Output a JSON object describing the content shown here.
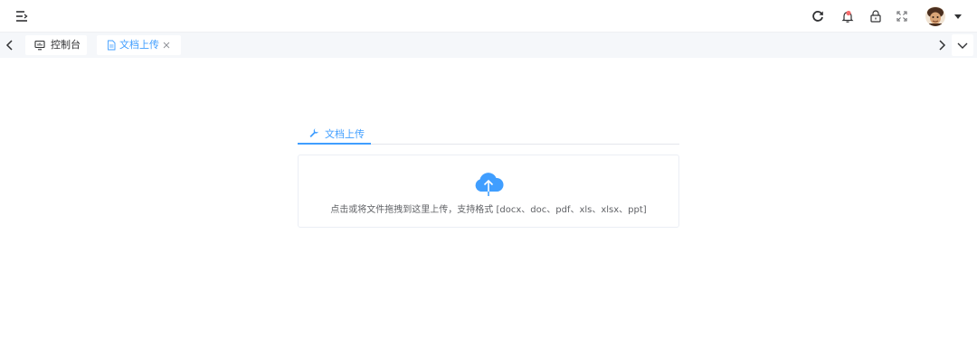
{
  "header": {
    "menu_icon": "hamburger-icon",
    "actions": [
      "refresh-icon",
      "bell-icon",
      "lock-icon",
      "fullscreen-icon"
    ],
    "avatar": "user-avatar"
  },
  "tags": [
    {
      "label": "控制台",
      "icon": "dashboard-icon",
      "active": false
    },
    {
      "label": "文档上传",
      "icon": "document-icon",
      "active": true
    }
  ],
  "content": {
    "tab_label": "文档上传",
    "tab_icon": "wrench-icon",
    "upload_icon": "cloud-upload-icon",
    "upload_text": "点击或将文件拖拽到这里上传，支持格式 [docx、doc、pdf、xls、xlsx、ppt]"
  },
  "colors": {
    "accent": "#409eff",
    "notify": "#f56c6c"
  }
}
